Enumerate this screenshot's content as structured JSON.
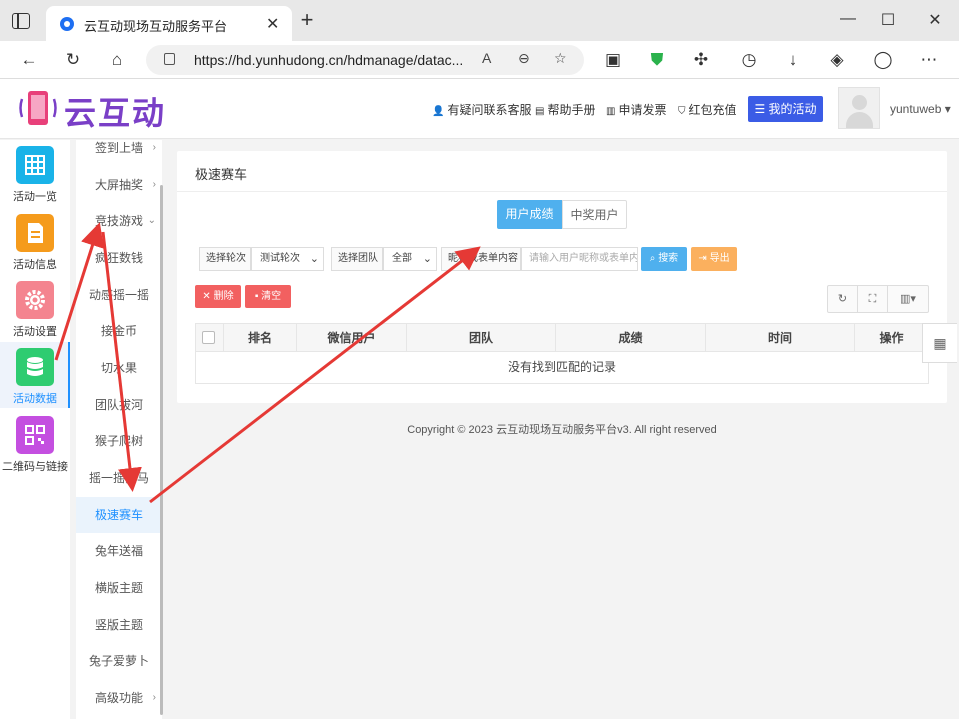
{
  "browser": {
    "tab_title": "云互动现场互动服务平台",
    "url": "https://hd.yunhudong.cn/hdmanage/datac...",
    "tab_close": "✕",
    "new_tab": "+",
    "win_min": "—",
    "win_max": "☐",
    "win_close": "✕"
  },
  "header": {
    "logo_text": "云互动",
    "links": [
      "有疑问联系客服",
      "帮助手册",
      "申请发票",
      "红包充值"
    ],
    "my_activity": "我的活动",
    "username": "yuntuweb"
  },
  "icon_nav": [
    {
      "label": "活动一览",
      "color": "#1ab3e8"
    },
    {
      "label": "活动信息",
      "color": "#f59b1c"
    },
    {
      "label": "活动设置",
      "color": "#f4848f"
    },
    {
      "label": "活动数据",
      "color": "#2ecc71"
    },
    {
      "label": "二维码与链接",
      "color": "#c44fe0"
    }
  ],
  "sub_menu": [
    "签到上墙",
    "大屏抽奖",
    "竞技游戏",
    "疯狂数钱",
    "动感摇一摇",
    "接金币",
    "切水果",
    "团队拔河",
    "猴子爬树",
    "摇一摇赛马",
    "极速赛车",
    "兔年送福",
    "横版主题",
    "竖版主题",
    "兔子爱萝卜",
    "高级功能"
  ],
  "sub_menu_active": "极速赛车",
  "card": {
    "title": "极速赛车",
    "tabs": [
      "用户成绩",
      "中奖用户"
    ],
    "filter": {
      "round_label": "选择轮次",
      "round_value": "测试轮次",
      "team_label": "选择团队",
      "team_value": "全部",
      "keyword_label": "昵称或表单内容",
      "keyword_placeholder": "请输入用户昵称或表单内容",
      "search_btn": "搜索",
      "export_btn": "导出"
    },
    "actions": {
      "delete": "删除",
      "clear": "清空"
    },
    "columns": [
      "排名",
      "微信用户",
      "团队",
      "成绩",
      "时间",
      "操作"
    ],
    "empty_text": "没有找到匹配的记录"
  },
  "footer": {
    "copyright": "Copyright © 2023 云互动现场互动服务平台v3. All right reserved"
  }
}
